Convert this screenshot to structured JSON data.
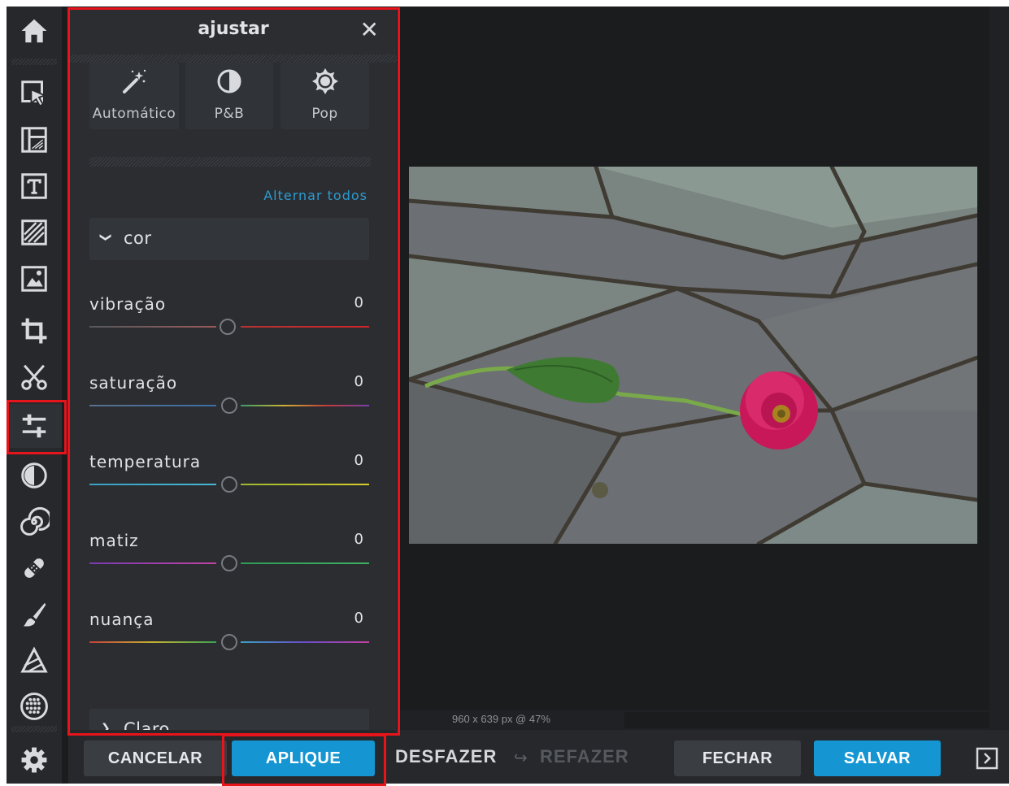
{
  "panel": {
    "title": "ajustar",
    "close_glyph": "✕",
    "presets": [
      {
        "label": "Automático",
        "icon": "magic-wand-icon"
      },
      {
        "label": "P&B",
        "icon": "contrast-icon"
      },
      {
        "label": "Pop",
        "icon": "sun-gear-icon"
      }
    ],
    "toggle_all": "Alternar todos",
    "section_color": {
      "chevron": "❯",
      "label": "cor",
      "expanded": true
    },
    "section_light": {
      "label": "Claro",
      "expanded": false
    },
    "sliders": [
      {
        "label": "vibração",
        "value": "0",
        "left_color": [
          "#57595d",
          "#9b5a5a"
        ],
        "right_color": [
          "#b73333",
          "#d0262b"
        ]
      },
      {
        "label": "saturação",
        "value": "0",
        "left_color": [
          "#5a6f8a",
          "#3e6ea8"
        ],
        "right_color": [
          "#3a9c66",
          "#cfb233",
          "#c33b3b",
          "#7a3fb0"
        ]
      },
      {
        "label": "temperatura",
        "value": "0",
        "left_color": [
          "#3aa0c2",
          "#48b7d3"
        ],
        "right_color": [
          "#9fb830",
          "#d7cd2a"
        ]
      },
      {
        "label": "matiz",
        "value": "0",
        "left_color": [
          "#7a3bb0",
          "#c243a5"
        ],
        "right_color": [
          "#2f9c56",
          "#3db061"
        ]
      },
      {
        "label": "nuança",
        "value": "0",
        "left_color": [
          "#c7423a",
          "#c4b232",
          "#3aa456"
        ],
        "right_color": [
          "#3aa1c4",
          "#6a4dc6",
          "#c23fa2"
        ]
      }
    ]
  },
  "toolbar": {
    "icons": [
      "home-icon",
      "select-icon",
      "layout-icon",
      "text-icon",
      "overlay-icon",
      "image-icon",
      "crop-icon",
      "cutout-icon",
      "adjust-icon",
      "effects-icon",
      "distort-icon",
      "heal-icon",
      "paint-icon",
      "draw-icon",
      "pattern-icon",
      "settings-icon"
    ],
    "active": "adjust-icon"
  },
  "bottom": {
    "cancel": "CANCELAR",
    "apply": "APLIQUE",
    "undo": "DESFAZER",
    "redo": "REFAZER",
    "close": "FECHAR",
    "save": "SALVAR"
  },
  "status": {
    "image_info": "960 x 639 px @ 47%"
  },
  "colors": {
    "accent": "#1596d2",
    "highlight": "#e8141b",
    "panel_bg": "#2b2d31"
  }
}
